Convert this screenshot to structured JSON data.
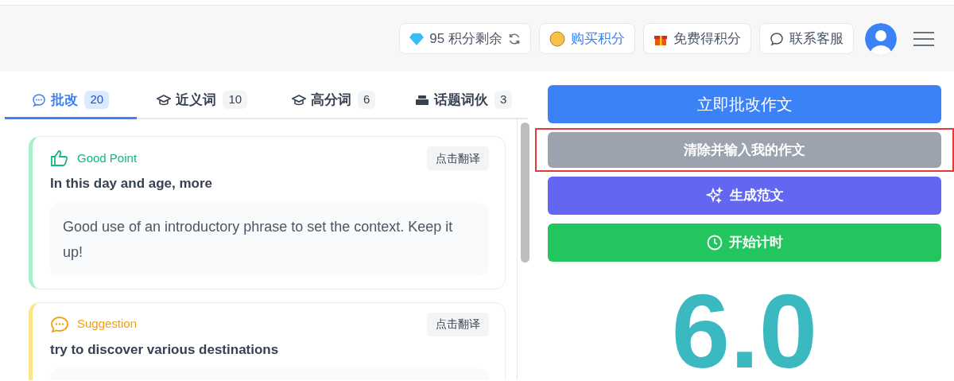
{
  "header": {
    "buttons": [
      {
        "kind": "credits",
        "label": "95 积分剩余"
      },
      {
        "kind": "buy",
        "label": "购买积分"
      },
      {
        "kind": "free",
        "label": "免费得积分"
      },
      {
        "kind": "support",
        "label": "联系客服"
      }
    ]
  },
  "tabs": [
    {
      "kind": "comments",
      "label": "批改",
      "count": "20",
      "selected": true
    },
    {
      "kind": "cap",
      "label": "近义词",
      "count": "10",
      "selected": false
    },
    {
      "kind": "cap",
      "label": "高分词",
      "count": "6",
      "selected": false
    },
    {
      "kind": "stack",
      "label": "话题词伙",
      "count": "3",
      "selected": false
    }
  ],
  "cards": [
    {
      "kind": "good",
      "title": "Good Point",
      "translate": "点击翻译",
      "quote": "In this day and age, more",
      "comment": "Good use of an introductory phrase to set the context. Keep it up!"
    },
    {
      "kind": "suggestion",
      "title": "Suggestion",
      "translate": "点击翻译",
      "quote": "try to discover various destinations"
    }
  ],
  "actions": [
    {
      "kind": "primary",
      "label": "立即批改作文",
      "highlighted": false
    },
    {
      "kind": "clear",
      "label": "清除并输入我的作文",
      "highlighted": true
    },
    {
      "kind": "generate",
      "label": "生成范文",
      "highlighted": false
    },
    {
      "kind": "timer",
      "label": "开始计时",
      "highlighted": false
    }
  ],
  "score": "6.0"
}
